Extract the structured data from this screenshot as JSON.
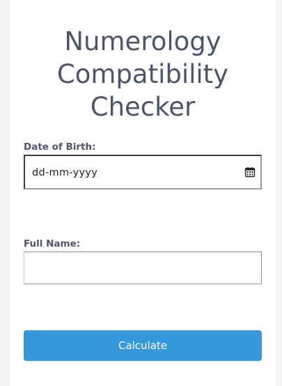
{
  "header": {
    "title_lines": [
      "Numerology",
      "Compatibility",
      "Checker"
    ]
  },
  "form": {
    "dob_label": "Date of Birth:",
    "dob_placeholder": "dd-mm-yyyy",
    "name_label": "Full Name:",
    "name_value": "",
    "calculate_label": "Calculate"
  },
  "icons": {
    "date_picker": "calendar-icon"
  },
  "colors": {
    "title": "#4a5668",
    "button": "#3498db",
    "button_text": "#ffffff"
  }
}
